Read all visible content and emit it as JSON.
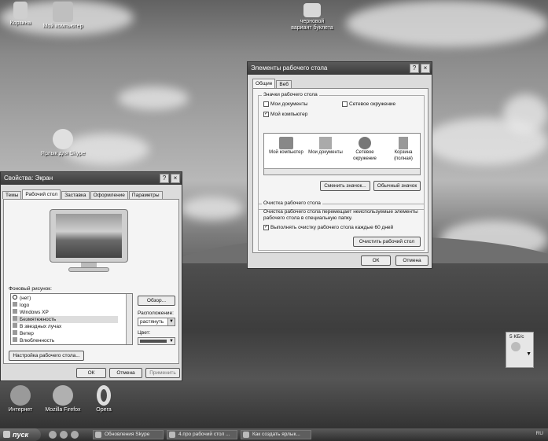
{
  "desktop": {
    "icons": [
      {
        "label": "Корзина"
      },
      {
        "label": "Мой компьютер"
      },
      {
        "label": "черновой\nвариант буклета"
      },
      {
        "label": "Ярлык для Skype"
      },
      {
        "label": "Интернет"
      },
      {
        "label": "Mozilla Firefox"
      },
      {
        "label": "Opera"
      }
    ]
  },
  "display_props": {
    "title": "Свойства: Экран",
    "help_btn": "?",
    "close_btn": "×",
    "tabs": [
      "Темы",
      "Рабочий стол",
      "Заставка",
      "Оформление",
      "Параметры"
    ],
    "bg_label": "Фоновый рисунок:",
    "bg_items": [
      "(нет)",
      "logo",
      "Windows XP",
      "Безмятежность",
      "В звездных лучах",
      "Ветер",
      "Влюбленность"
    ],
    "browse_btn": "Обзор...",
    "position_label": "Расположение:",
    "position_value": "растянуть",
    "color_label": "Цвет:",
    "customize_btn": "Настройка рабочего стола...",
    "ok": "ОК",
    "cancel": "Отмена",
    "apply": "Применить",
    "colors": {
      "swatch": "#505050"
    }
  },
  "desktop_items": {
    "title": "Элементы рабочего стола",
    "help_btn": "?",
    "close_btn": "×",
    "tabs": [
      "Общие",
      "Веб"
    ],
    "icons_group": "Значки рабочего стола",
    "checkboxes": [
      {
        "label": "Мои документы",
        "checked": false
      },
      {
        "label": "Сетевое окружение",
        "checked": false
      },
      {
        "label": "Мой компьютер",
        "checked": true
      }
    ],
    "preview_icons": [
      "Мой компьютер",
      "Мои документы",
      "Сетевое\nокружение",
      "Корзина\n(полная)"
    ],
    "change_icon_btn": "Сменить значок...",
    "default_icon_btn": "Обычный значок",
    "cleanup_group": "Очистка рабочего стола",
    "cleanup_text": "Очистка рабочего стола перемещает неиспользуемые элементы рабочего стола в специальную папку.",
    "cleanup_checkbox": "Выполнять очистку рабочего стола каждые 60 дней",
    "cleanup_btn": "Очистить рабочий стол",
    "ok": "ОК",
    "cancel": "Отмена"
  },
  "gadget": {
    "label": "5 КБ/с"
  },
  "taskbar": {
    "start": "пуск",
    "items": [
      "Обновления Skype",
      "4.про рабочий стол ...",
      "Как создать ярлык..."
    ],
    "lang": "RU"
  }
}
